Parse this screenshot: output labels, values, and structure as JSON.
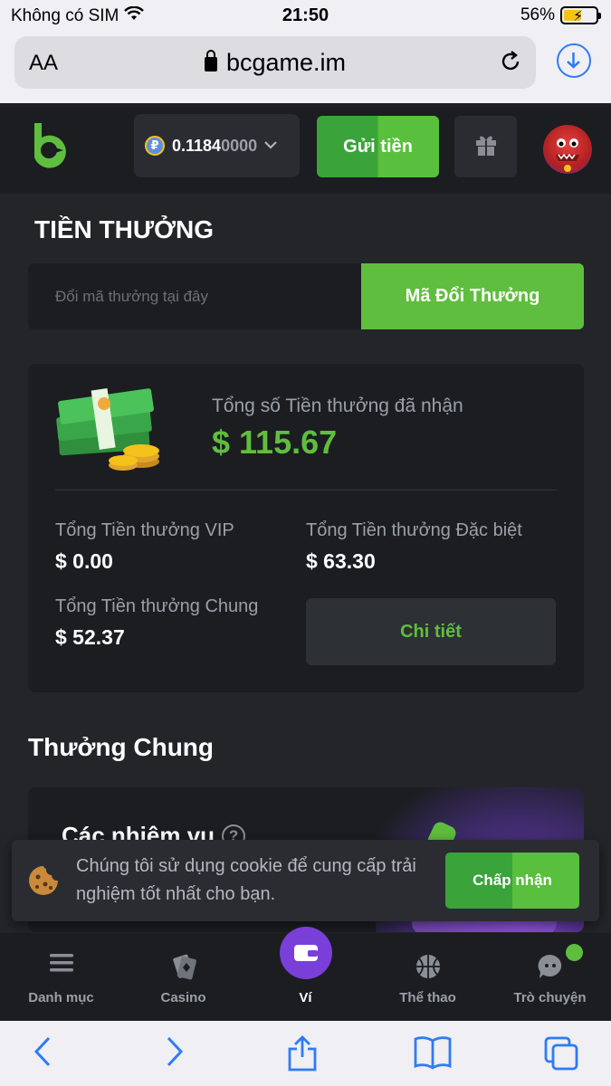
{
  "status_bar": {
    "carrier": "Không có SIM",
    "time": "21:50",
    "battery": "56%",
    "battery_level": 0.56
  },
  "browser": {
    "aa_label": "AA",
    "url": "bcgame.im"
  },
  "header": {
    "balance_bright": "0.1184",
    "balance_dim": "0000",
    "coin_symbol": "₽",
    "deposit_label": "Gửi tiền"
  },
  "bonus": {
    "title": "TIỀN THƯỞNG",
    "code_placeholder": "Đổi mã thưởng tại đây",
    "redeem_label": "Mã Đổi Thưởng",
    "total_label": "Tổng số Tiền thưởng đã nhận",
    "total_value": "$ 115.67",
    "vip_label": "Tổng Tiền thưởng VIP",
    "vip_value": "$ 0.00",
    "special_label": "Tổng Tiền thưởng Đặc biệt",
    "special_value": "$ 63.30",
    "general_label": "Tổng Tiền thưởng Chung",
    "general_value": "$ 52.37",
    "detail_label": "Chi tiết"
  },
  "general": {
    "section_title": "Thưởng Chung",
    "tasks_title": "Các nhiệm vụ",
    "help_symbol": "?"
  },
  "cookie": {
    "text": "Chúng tôi sử dụng cookie để cung cấp trải nghiệm tốt nhất cho bạn.",
    "accept_label": "Chấp nhận"
  },
  "tabs": [
    {
      "label": "Danh mục",
      "icon": "menu-icon"
    },
    {
      "label": "Casino",
      "icon": "cards-icon"
    },
    {
      "label": "Ví",
      "icon": "wallet-icon",
      "active": true
    },
    {
      "label": "Thể thao",
      "icon": "basketball-icon"
    },
    {
      "label": "Trò chuyện",
      "icon": "chat-icon"
    }
  ],
  "colors": {
    "accent_green": "#5fbe3d",
    "wallet_purple": "#7a3fd8",
    "background": "#232529",
    "card": "#1b1d21"
  }
}
